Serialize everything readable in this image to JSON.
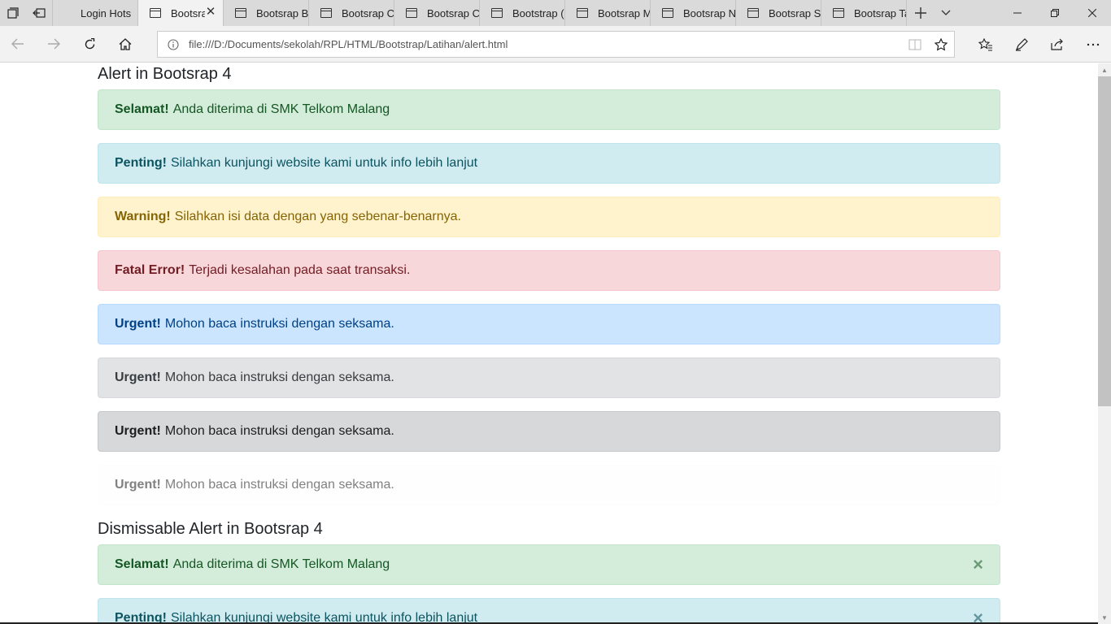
{
  "tabs": [
    {
      "label": "Login Hots",
      "active": false
    },
    {
      "label": "Bootsrap",
      "active": true
    },
    {
      "label": "Bootsrap B",
      "active": false
    },
    {
      "label": "Bootsrap C",
      "active": false
    },
    {
      "label": "Bootsrap C",
      "active": false
    },
    {
      "label": "Bootstrap (",
      "active": false
    },
    {
      "label": "Bootsrap M",
      "active": false
    },
    {
      "label": "Bootsrap N",
      "active": false
    },
    {
      "label": "Bootsrap S",
      "active": false
    },
    {
      "label": "Bootsrap Ta",
      "active": false
    }
  ],
  "address": {
    "url": "file:///D:/Documents/sekolah/RPL/HTML/Bootstrap/Latihan/alert.html"
  },
  "icons": {
    "tab_manager": "tab-manager-icon",
    "set_aside": "set-aside-icon",
    "back": "back-arrow-icon",
    "forward": "forward-arrow-icon",
    "refresh": "refresh-icon",
    "home": "home-icon",
    "info": "info-icon",
    "reading_view": "reading-view-icon",
    "favorite": "star-icon",
    "favorites_hub": "favorites-hub-icon",
    "web_note": "pen-icon",
    "share": "share-icon",
    "more": "more-icon"
  },
  "page": {
    "heading1": "Alert in Bootsrap 4",
    "alerts": [
      {
        "variant": "success",
        "strong": "Selamat!",
        "text": "Anda diterima di SMK Telkom Malang"
      },
      {
        "variant": "info",
        "strong": "Penting!",
        "text": "Silahkan kunjungi website kami untuk info lebih lanjut"
      },
      {
        "variant": "warning",
        "strong": "Warning!",
        "text": "Silahkan isi data dengan yang sebenar-benarnya."
      },
      {
        "variant": "danger",
        "strong": "Fatal Error!",
        "text": "Terjadi kesalahan pada saat transaksi."
      },
      {
        "variant": "primary",
        "strong": "Urgent!",
        "text": "Mohon baca instruksi dengan seksama."
      },
      {
        "variant": "secondary",
        "strong": "Urgent!",
        "text": "Mohon baca instruksi dengan seksama."
      },
      {
        "variant": "dark",
        "strong": "Urgent!",
        "text": "Mohon baca instruksi dengan seksama."
      },
      {
        "variant": "light",
        "strong": "Urgent!",
        "text": "Mohon baca instruksi dengan seksama."
      }
    ],
    "heading2": "Dismissable Alert in Bootsrap 4",
    "dismissable_alerts": [
      {
        "variant": "success",
        "strong": "Selamat!",
        "text": "Anda diterima di SMK Telkom Malang",
        "close": "×"
      },
      {
        "variant": "info",
        "strong": "Penting!",
        "text": "Silahkan kunjungi website kami untuk info lebih lanjut",
        "close": "×"
      }
    ]
  }
}
